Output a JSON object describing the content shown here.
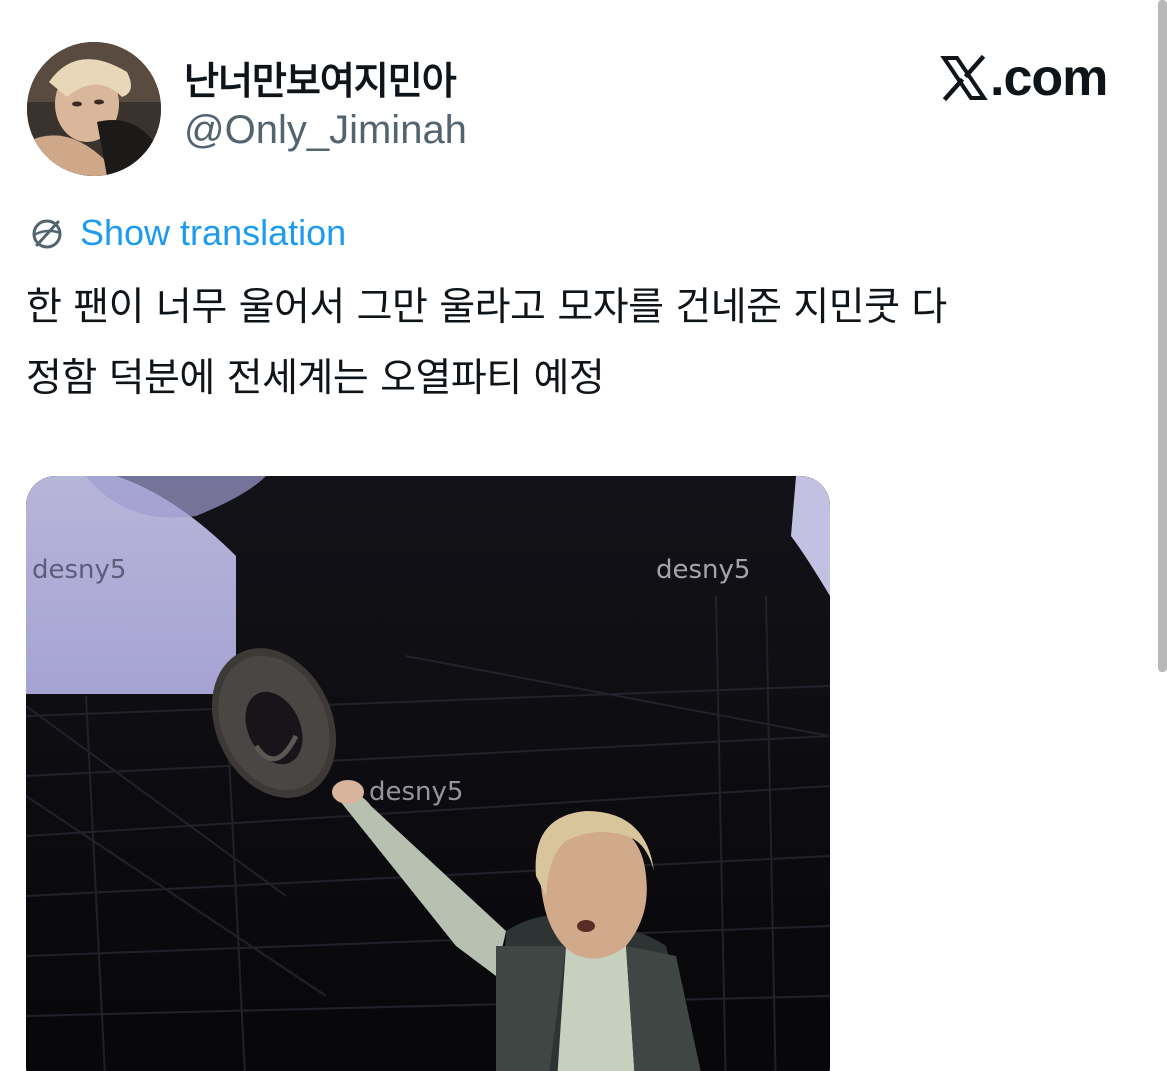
{
  "header": {
    "display_name": "난너만보여지민아",
    "handle": "@Only_Jiminah",
    "brand": ".com",
    "brand_logo": "x-logo-icon"
  },
  "translate": {
    "label": "Show translation",
    "icon": "globe-icon",
    "color": "#1d9bf0"
  },
  "tweet": {
    "line1": "한 팬이 너무 울어서 그만 울라고 모자를 건네준 지민쿳 다",
    "line2": "정함 덕분에 전세계는 오열파티 예정"
  },
  "media": {
    "watermarks": [
      "desny5",
      "desny5",
      "desny5"
    ]
  }
}
